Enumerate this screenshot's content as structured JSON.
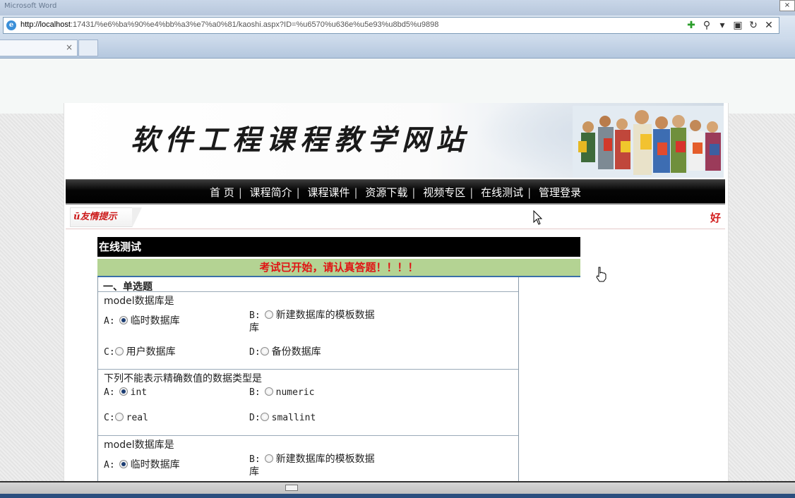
{
  "browser": {
    "title_bar_text": "Microsoft Word",
    "url_host": "http://localhost",
    "url_rest": ":17431/%e6%ba%90%e4%bb%a3%e7%a0%81/kaoshi.aspx?ID=%u6570%u636e%u5e93%u8bd5%u9898",
    "tab_close": "×",
    "window_close": "×"
  },
  "site": {
    "title": "软件工程课程教学网站",
    "nav": [
      "首 页",
      "课程简介",
      "课程课件",
      "资源下载",
      "视频专区",
      "在线测试",
      "管理登录"
    ],
    "nav_separator": "|",
    "tip_label": "友情提示",
    "marquee_text": "好"
  },
  "exam": {
    "header": "在线测试",
    "notice": "考试已开始，请认真答题！！！！",
    "section_title": "一、单选题",
    "questions": [
      {
        "text": "model数据库是",
        "options": [
          {
            "letter": "A:",
            "label": "临时数据库",
            "checked": true
          },
          {
            "letter": "B:",
            "label": "新建数据库的模板数据",
            "label_wrap": "库",
            "checked": false
          },
          {
            "letter": "C:",
            "label": "用户数据库",
            "checked": false
          },
          {
            "letter": "D:",
            "label": "备份数据库",
            "checked": false
          }
        ]
      },
      {
        "text": "下列不能表示精确数值的数据类型是",
        "options": [
          {
            "letter": "A:",
            "label": "int",
            "checked": true
          },
          {
            "letter": "B:",
            "label": "numeric",
            "checked": false
          },
          {
            "letter": "C:",
            "label": "real",
            "checked": false
          },
          {
            "letter": "D:",
            "label": "smallint",
            "checked": false
          }
        ]
      },
      {
        "text": "model数据库是",
        "options": [
          {
            "letter": "A:",
            "label": "临时数据库",
            "checked": true
          },
          {
            "letter": "B:",
            "label": "新建数据库的模板数据",
            "label_wrap": "库",
            "checked": false
          }
        ]
      }
    ]
  },
  "colors": {
    "notice_bg": "#b4d393",
    "notice_text": "#e01414",
    "header_bg": "#000000"
  }
}
